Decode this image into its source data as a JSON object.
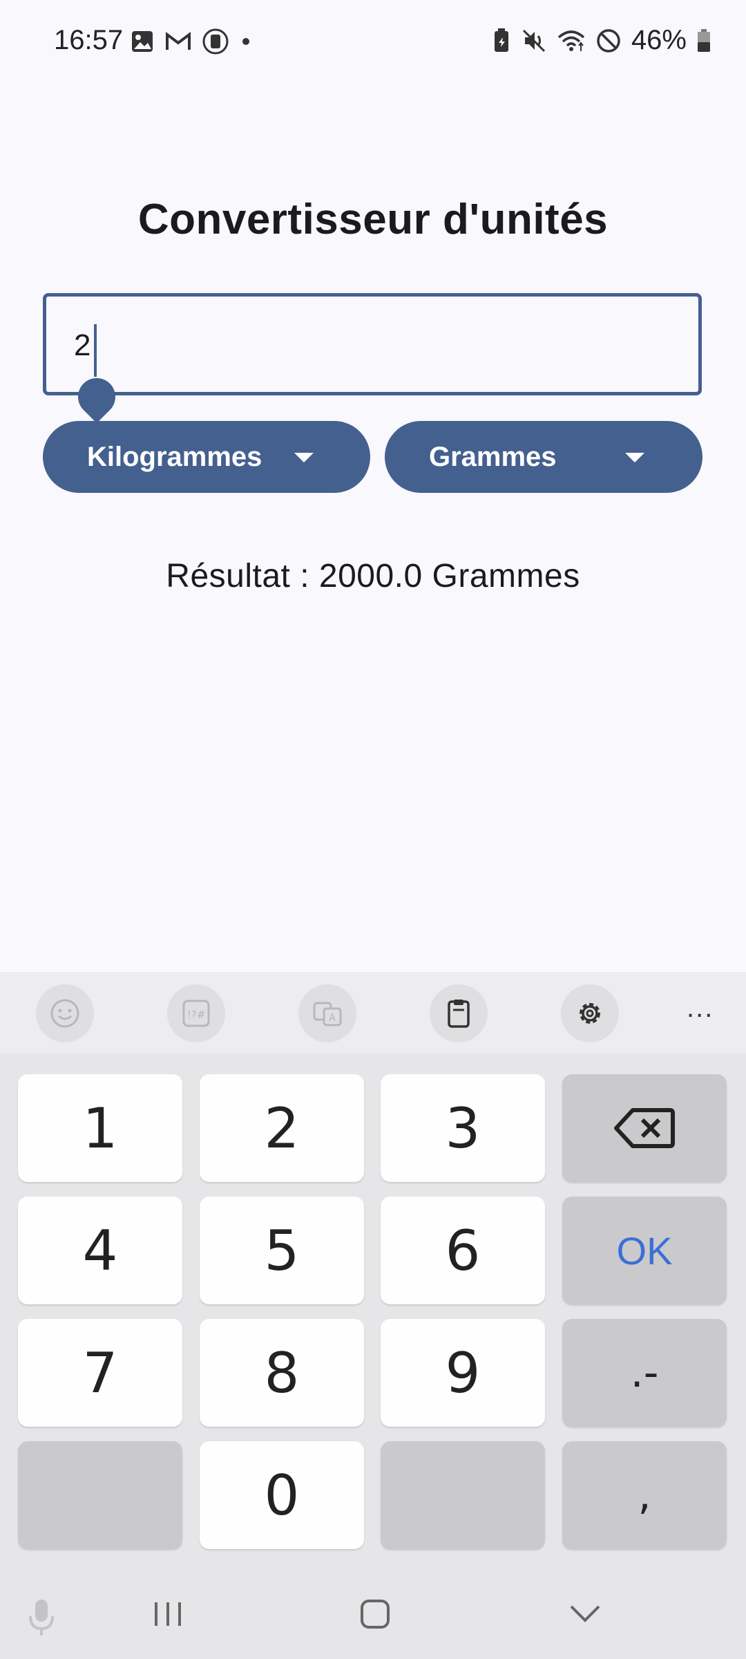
{
  "status_bar": {
    "time": "16:57",
    "battery_percent": "46%",
    "left_icons": [
      "image-icon",
      "gmail-icon",
      "vpn-icon",
      "dot-icon"
    ],
    "right_icons": [
      "battery-saver-icon",
      "mute-icon",
      "wifi-icon",
      "dnd-icon",
      "battery-icon"
    ]
  },
  "app": {
    "title": "Convertisseur d'unités",
    "input": {
      "value": "2"
    },
    "from_unit": "Kilogrammes",
    "to_unit": "Grammes",
    "result": "Résultat : 2000.0 Grammes",
    "accent_color": "#44608f"
  },
  "keyboard": {
    "toolbar_icons": [
      "emoji-icon",
      "symbols-icon",
      "translate-icon",
      "clipboard-icon",
      "settings-icon",
      "more-icon"
    ],
    "more_label": "...",
    "keys": {
      "k1": "1",
      "k2": "2",
      "k3": "3",
      "k4": "4",
      "k5": "5",
      "k6": "6",
      "k7": "7",
      "k8": "8",
      "k9": "9",
      "k0": "0",
      "ok": "OK",
      "dot_minus": ".-",
      "comma": ","
    }
  },
  "nav_bar": {
    "icons": [
      "mic-icon",
      "recents-icon",
      "home-icon",
      "hide-keyboard-icon"
    ]
  }
}
